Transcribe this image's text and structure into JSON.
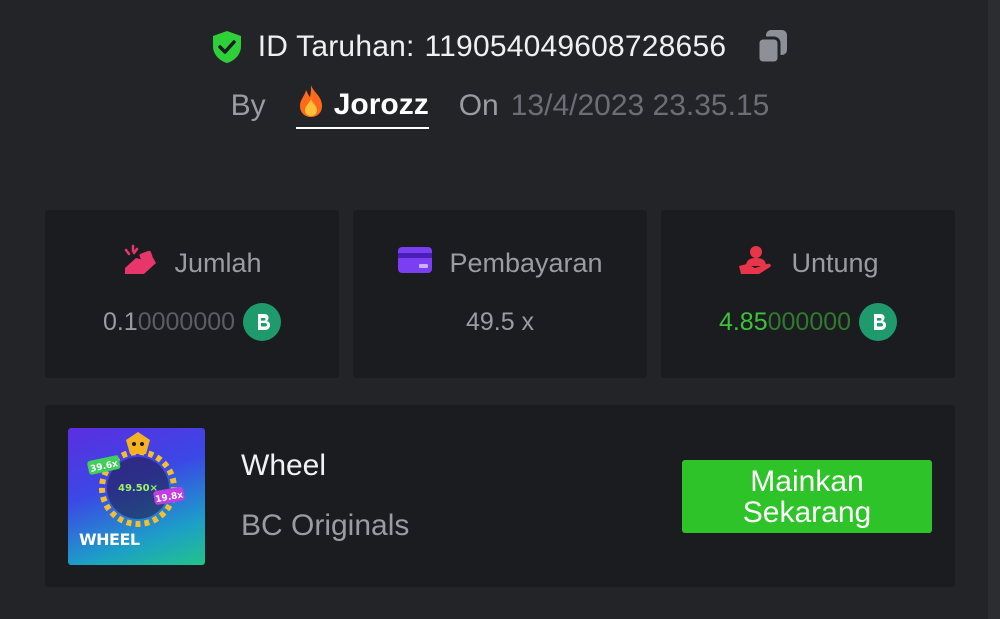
{
  "bet": {
    "id_label": "ID Taruhan:",
    "id_value": "119054049608728656",
    "by_label": "By",
    "username": "Jorozz",
    "on_label": "On",
    "date": "13/4/2023 23.35.15"
  },
  "stats": {
    "amount": {
      "label": "Jumlah",
      "value_main": "0.1",
      "value_trail": "0000000",
      "coin_icon": "bc-coin-icon"
    },
    "payout": {
      "label": "Pembayaran",
      "value": "49.5 x"
    },
    "profit": {
      "label": "Untung",
      "value_main": "4.85",
      "value_trail": "000000",
      "coin_icon": "bc-coin-icon"
    }
  },
  "game": {
    "name": "Wheel",
    "provider": "BC Originals",
    "play_button": "Mainkan Sekarang",
    "thumbnail": {
      "word": "WHEEL",
      "multiplier_center": "49.50×",
      "multiplier_left": "39.6x",
      "multiplier_right": "19.8x"
    }
  },
  "colors": {
    "background": "#232427",
    "card": "#1b1c1f",
    "accent_green": "#2fc32a",
    "profit_green": "#3dc23a",
    "shield_green": "#2fcf3a",
    "coin_green": "#1e9a6c"
  }
}
